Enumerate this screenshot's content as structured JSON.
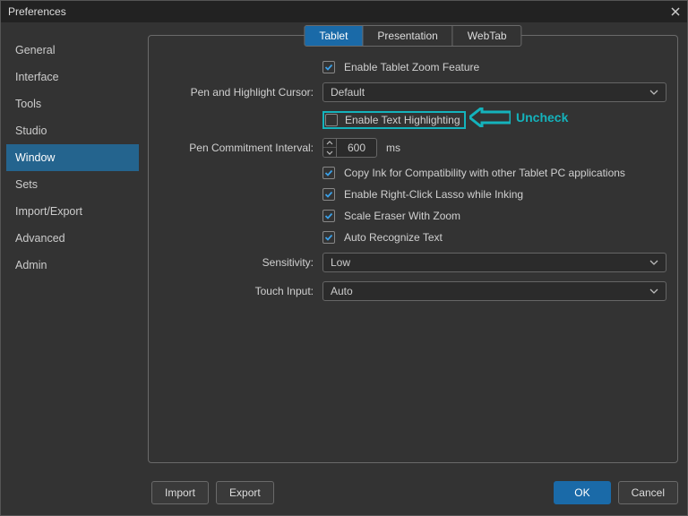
{
  "title": "Preferences",
  "sidebar": {
    "items": [
      {
        "label": "General"
      },
      {
        "label": "Interface"
      },
      {
        "label": "Tools"
      },
      {
        "label": "Studio"
      },
      {
        "label": "Window"
      },
      {
        "label": "Sets"
      },
      {
        "label": "Import/Export"
      },
      {
        "label": "Advanced"
      },
      {
        "label": "Admin"
      }
    ],
    "selected_index": 4
  },
  "tabs": [
    {
      "label": "Tablet",
      "active": true
    },
    {
      "label": "Presentation",
      "active": false
    },
    {
      "label": "WebTab",
      "active": false
    }
  ],
  "form": {
    "enable_zoom": {
      "label": "Enable Tablet Zoom Feature",
      "checked": true
    },
    "cursor_label": "Pen and Highlight Cursor:",
    "cursor_value": "Default",
    "enable_text_highlight": {
      "label": "Enable Text Highlighting",
      "checked": false
    },
    "commit_label": "Pen Commitment Interval:",
    "commit_value": "600",
    "commit_unit": "ms",
    "copy_ink": {
      "label": "Copy Ink for Compatibility with other Tablet PC applications",
      "checked": true
    },
    "right_click_lasso": {
      "label": "Enable Right-Click Lasso while Inking",
      "checked": true
    },
    "scale_eraser": {
      "label": "Scale Eraser With Zoom",
      "checked": true
    },
    "auto_recognize": {
      "label": "Auto Recognize Text",
      "checked": true
    },
    "sensitivity_label": "Sensitivity:",
    "sensitivity_value": "Low",
    "touch_label": "Touch Input:",
    "touch_value": "Auto"
  },
  "annotation": {
    "text": "Uncheck"
  },
  "buttons": {
    "import": "Import",
    "export": "Export",
    "ok": "OK",
    "cancel": "Cancel"
  },
  "colors": {
    "accent": "#1a6aa8",
    "annotation": "#14b3bc"
  }
}
